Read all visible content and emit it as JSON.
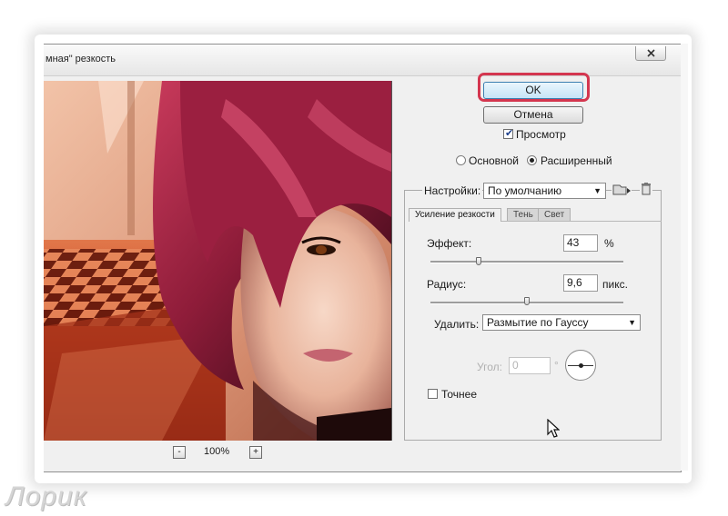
{
  "window": {
    "title": "мная\" резкость"
  },
  "preview": {
    "zoom_out_label": "-",
    "zoom_in_label": "+",
    "zoom_level": "100%"
  },
  "buttons": {
    "ok_label": "OK",
    "cancel_label": "Отмена"
  },
  "preview_toggle": {
    "label": "Просмотр",
    "checked": true
  },
  "mode": {
    "basic_label": "Основной",
    "advanced_label": "Расширенный",
    "selected": "advanced"
  },
  "settings": {
    "label": "Настройки:",
    "value": "По умолчанию"
  },
  "tabs": [
    {
      "label": "Усиление резкости",
      "active": true
    },
    {
      "label": "Тень",
      "active": false
    },
    {
      "label": "Свет",
      "active": false
    }
  ],
  "amount": {
    "label": "Эффект:",
    "value": "43",
    "unit": "%",
    "slider_fraction": 0.25
  },
  "radius": {
    "label": "Радиус:",
    "value": "9,6",
    "unit": "пикс.",
    "slider_fraction": 0.5
  },
  "remove": {
    "label": "Удалить:",
    "value": "Размытие по Гауссу"
  },
  "angle": {
    "label": "Угол:",
    "value": "0",
    "unit": "°"
  },
  "more_accurate": {
    "label": "Точнее",
    "checked": false
  },
  "watermark": "Лорик",
  "colors": {
    "highlight": "#d4364f",
    "ok_border": "#3c7fb1"
  }
}
